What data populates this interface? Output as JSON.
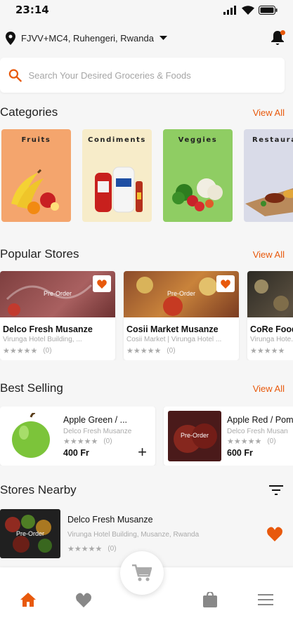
{
  "status": {
    "time": "23:14"
  },
  "location": {
    "address": "FJVV+MC4, Ruhengeri, Rwanda"
  },
  "search": {
    "placeholder": "Search Your Desired Groceries & Foods"
  },
  "categories": {
    "title": "Categories",
    "view_all": "View All",
    "items": [
      {
        "label": "Fruits",
        "bg": "#f4a56d"
      },
      {
        "label": "Condiments",
        "bg": "#f7ecc9"
      },
      {
        "label": "Veggies",
        "bg": "#8fcd63"
      },
      {
        "label": "Restaurants",
        "bg": "#d9dbe8"
      }
    ]
  },
  "popular_stores": {
    "title": "Popular Stores",
    "view_all": "View All",
    "preorder_label": "Pre-Order",
    "items": [
      {
        "name": "Delco Fresh Musanze",
        "address": "Virunga Hotel Building, ...",
        "reviews": "(0)"
      },
      {
        "name": "Cosii Market Musanze",
        "address": "Cosii Market | Virunga Hotel ...",
        "reviews": "(0)"
      },
      {
        "name": "CoRe Foods",
        "address": "Virunga Hote...",
        "reviews": ""
      }
    ]
  },
  "best_selling": {
    "title": "Best Selling",
    "view_all": "View All",
    "items": [
      {
        "name": "Apple Green / ...",
        "store": "Delco Fresh Musanze",
        "reviews": "(0)",
        "price": "400 Fr"
      },
      {
        "name": "Apple Red / Pom",
        "store": "Delco Fresh Musan",
        "reviews": "(0)",
        "price": "600 Fr",
        "preorder": "Pre-Order"
      }
    ]
  },
  "stores_nearby": {
    "title": "Stores Nearby",
    "items": [
      {
        "name": "Delco Fresh Musanze",
        "address": "Virunga Hotel Building, Musanze, Rwanda",
        "reviews": "(0)",
        "preorder": "Pre-Order"
      }
    ]
  },
  "colors": {
    "accent": "#e8590c",
    "background": "#f6f6f6"
  },
  "icons": [
    "location-pin-icon",
    "caret-down-icon",
    "bell-icon",
    "search-icon",
    "heart-icon",
    "filter-icon",
    "home-icon",
    "cart-icon",
    "bag-icon",
    "menu-icon"
  ]
}
